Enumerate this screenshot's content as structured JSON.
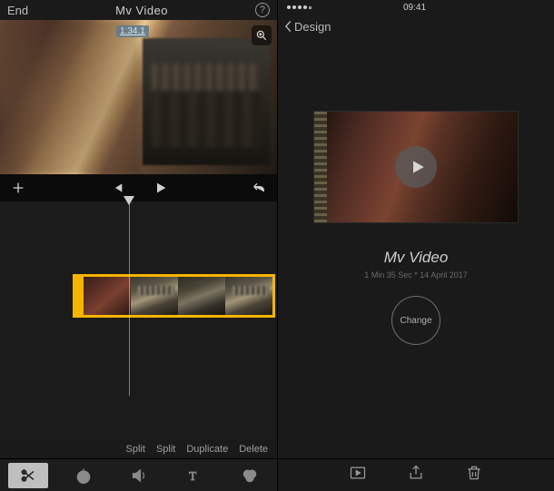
{
  "left": {
    "topbar": {
      "end_label": "End",
      "title": "Mv Video"
    },
    "preview": {
      "duration_badge": "1:34.1"
    },
    "actions": {
      "split1": "Split",
      "split2": "Split",
      "duplicate": "Duplicate",
      "delete": "Delete"
    }
  },
  "right": {
    "statusbar": {
      "time": "09:41"
    },
    "navbar": {
      "back_label": "Design"
    },
    "video": {
      "title": "Mv Video",
      "meta": "1 Min 35 Sec * 14 April 2017",
      "change_label": "Change"
    }
  }
}
